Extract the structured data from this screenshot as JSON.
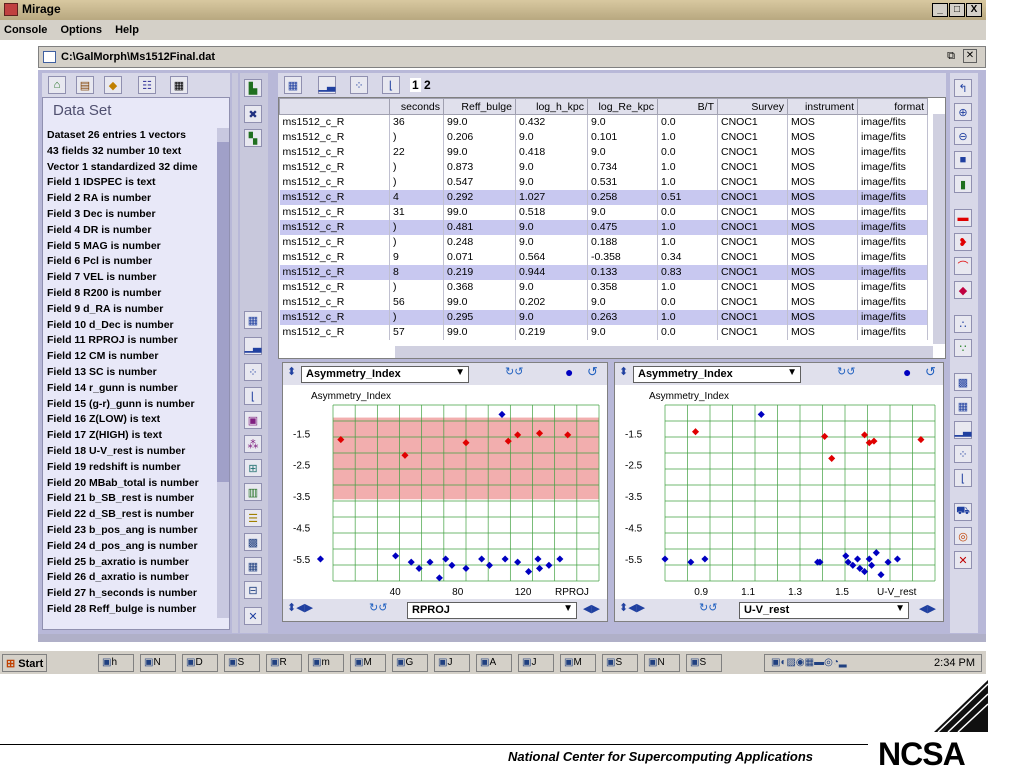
{
  "window": {
    "title": "Mirage",
    "min": "_",
    "max": "□",
    "close": "X"
  },
  "menu": [
    "Console",
    "Options",
    "Help"
  ],
  "file_path": "C:\\GalMorph\\Ms1512Final.dat",
  "data_set": {
    "title": "Data Set",
    "lines": [
      "Dataset 26 entries 1 vectors",
      "43 fields 32 number 10 text",
      "Vector 1 standardized 32 dime",
      "Field 1 IDSPEC is text",
      "Field 2 RA is number",
      "Field 3 Dec is number",
      "Field 4 DR is number",
      "Field 5 MAG is number",
      "Field 6 Pcl is number",
      "Field 7 VEL is number",
      "Field 8 R200 is number",
      "Field 9 d_RA is number",
      "Field 10 d_Dec is number",
      "Field 11 RPROJ is number",
      "Field 12 CM is number",
      "Field 13 SC is number",
      "Field 14 r_gunn is number",
      "Field 15 (g-r)_gunn is number",
      "Field 16 Z(LOW) is text",
      "Field 17 Z(HIGH) is text",
      "Field 18 U-V_rest is number",
      "Field 19 redshift is number",
      "Field 20 MBab_total is number",
      "Field 21 b_SB_rest is number",
      "Field 22 d_SB_rest is number",
      "Field 23 b_pos_ang is number",
      "Field 24 d_pos_ang is number",
      "Field 25 b_axratio is number",
      "Field 26 d_axratio is number",
      "Field 27 h_seconds is number",
      "Field 28 Reff_bulge is number"
    ]
  },
  "table_tabs": [
    "1",
    "2"
  ],
  "table": {
    "headers": [
      "",
      "seconds",
      "Reff_bulge",
      "log_h_kpc",
      "log_Re_kpc",
      "B/T",
      "Survey",
      "instrument",
      "format"
    ],
    "rows": [
      [
        "ms1512_c_R",
        "36",
        "99.0",
        "0.432",
        "9.0",
        "0.0",
        "CNOC1",
        "MOS",
        "image/fits"
      ],
      [
        "ms1512_c_R",
        ")",
        "0.206",
        "9.0",
        "0.101",
        "1.0",
        "CNOC1",
        "MOS",
        "image/fits"
      ],
      [
        "ms1512_c_R",
        "22",
        "99.0",
        "0.418",
        "9.0",
        "0.0",
        "CNOC1",
        "MOS",
        "image/fits"
      ],
      [
        "ms1512_c_R",
        ")",
        "0.873",
        "9.0",
        "0.734",
        "1.0",
        "CNOC1",
        "MOS",
        "image/fits"
      ],
      [
        "ms1512_c_R",
        ")",
        "0.547",
        "9.0",
        "0.531",
        "1.0",
        "CNOC1",
        "MOS",
        "image/fits"
      ],
      [
        "ms1512_c_R",
        "4",
        "0.292",
        "1.027",
        "0.258",
        "0.51",
        "CNOC1",
        "MOS",
        "image/fits"
      ],
      [
        "ms1512_c_R",
        "31",
        "99.0",
        "0.518",
        "9.0",
        "0.0",
        "CNOC1",
        "MOS",
        "image/fits"
      ],
      [
        "ms1512_c_R",
        ")",
        "0.481",
        "9.0",
        "0.475",
        "1.0",
        "CNOC1",
        "MOS",
        "image/fits"
      ],
      [
        "ms1512_c_R",
        ")",
        "0.248",
        "9.0",
        "0.188",
        "1.0",
        "CNOC1",
        "MOS",
        "image/fits"
      ],
      [
        "ms1512_c_R",
        "9",
        "0.071",
        "0.564",
        "-0.358",
        "0.34",
        "CNOC1",
        "MOS",
        "image/fits"
      ],
      [
        "ms1512_c_R",
        "8",
        "0.219",
        "0.944",
        "0.133",
        "0.83",
        "CNOC1",
        "MOS",
        "image/fits"
      ],
      [
        "ms1512_c_R",
        ")",
        "0.368",
        "9.0",
        "0.358",
        "1.0",
        "CNOC1",
        "MOS",
        "image/fits"
      ],
      [
        "ms1512_c_R",
        "56",
        "99.0",
        "0.202",
        "9.0",
        "0.0",
        "CNOC1",
        "MOS",
        "image/fits"
      ],
      [
        "ms1512_c_R",
        ")",
        "0.295",
        "9.0",
        "0.263",
        "1.0",
        "CNOC1",
        "MOS",
        "image/fits"
      ],
      [
        "ms1512_c_R",
        "57",
        "99.0",
        "0.219",
        "9.0",
        "0.0",
        "CNOC1",
        "MOS",
        "image/fits"
      ]
    ],
    "highlighted": [
      5,
      7,
      10,
      13
    ]
  },
  "plots": [
    {
      "y_field": "Asymmetry_Index",
      "x_field": "RPROJ",
      "ytitle": "Asymmetry_Index",
      "yticks": [
        "-1.5",
        "-2.5",
        "-3.5",
        "-4.5",
        "-5.5"
      ],
      "xticks": [
        "40",
        "80",
        "120",
        "RPROJ"
      ]
    },
    {
      "y_field": "Asymmetry_Index",
      "x_field": "U-V_rest",
      "ytitle": "Asymmetry_Index",
      "yticks": [
        "-1.5",
        "-2.5",
        "-3.5",
        "-4.5",
        "-5.5"
      ],
      "xticks": [
        "0.9",
        "1.1",
        "1.3",
        "1.5",
        "U-V_rest"
      ]
    }
  ],
  "chart_data": [
    {
      "type": "scatter",
      "xlabel": "RPROJ",
      "ylabel": "Asymmetry_Index",
      "ylim": [
        -6.2,
        -0.6
      ],
      "xlim": [
        0,
        170
      ],
      "highlight_region": {
        "x": [
          0,
          170
        ],
        "y": [
          -3.6,
          -1.0
        ],
        "color": "#f0a0a0"
      },
      "series": [
        {
          "color": "#e00000",
          "points": [
            [
              5,
              -1.7
            ],
            [
              46,
              -2.2
            ],
            [
              85,
              -1.8
            ],
            [
              112,
              -1.75
            ],
            [
              118,
              -1.55
            ],
            [
              132,
              -1.5
            ],
            [
              150,
              -1.55
            ]
          ]
        },
        {
          "color": "#0000c0",
          "points": [
            [
              -8,
              -5.5
            ],
            [
              40,
              -5.4
            ],
            [
              50,
              -5.6
            ],
            [
              55,
              -5.8
            ],
            [
              62,
              -5.6
            ],
            [
              68,
              -6.1
            ],
            [
              72,
              -5.5
            ],
            [
              76,
              -5.7
            ],
            [
              85,
              -5.8
            ],
            [
              95,
              -5.5
            ],
            [
              100,
              -5.7
            ],
            [
              110,
              -5.5
            ],
            [
              118,
              -5.6
            ],
            [
              125,
              -5.9
            ],
            [
              131,
              -5.5
            ],
            [
              132,
              -5.8
            ],
            [
              138,
              -5.7
            ],
            [
              145,
              -5.5
            ],
            [
              108,
              -0.9
            ]
          ]
        }
      ]
    },
    {
      "type": "scatter",
      "xlabel": "U-V_rest",
      "ylabel": "Asymmetry_Index",
      "ylim": [
        -6.2,
        -0.6
      ],
      "xlim": [
        0.75,
        1.9
      ],
      "series": [
        {
          "color": "#e00000",
          "points": [
            [
              0.88,
              -1.45
            ],
            [
              1.43,
              -1.6
            ],
            [
              1.46,
              -2.3
            ],
            [
              1.6,
              -1.55
            ],
            [
              1.62,
              -1.8
            ],
            [
              1.64,
              -1.75
            ],
            [
              1.84,
              -1.7
            ]
          ]
        },
        {
          "color": "#0000c0",
          "points": [
            [
              0.75,
              -5.5
            ],
            [
              0.86,
              -5.6
            ],
            [
              0.92,
              -5.5
            ],
            [
              1.4,
              -5.6
            ],
            [
              1.41,
              -5.6
            ],
            [
              1.52,
              -5.4
            ],
            [
              1.53,
              -5.6
            ],
            [
              1.55,
              -5.7
            ],
            [
              1.57,
              -5.5
            ],
            [
              1.58,
              -5.8
            ],
            [
              1.6,
              -5.9
            ],
            [
              1.62,
              -5.5
            ],
            [
              1.63,
              -5.7
            ],
            [
              1.65,
              -5.3
            ],
            [
              1.67,
              -6.0
            ],
            [
              1.7,
              -5.6
            ],
            [
              1.74,
              -5.5
            ],
            [
              1.16,
              -0.9
            ]
          ]
        }
      ]
    }
  ],
  "taskbar": {
    "start": "Start",
    "items": [
      "h",
      "N",
      "D",
      "S",
      "R",
      "m",
      "M",
      "G",
      "J",
      "A",
      "J",
      "M",
      "S",
      "N",
      "S"
    ],
    "clock": "2:34 PM"
  },
  "footer": {
    "text": "National Center for Supercomputing Applications",
    "logo": "NCSA"
  }
}
